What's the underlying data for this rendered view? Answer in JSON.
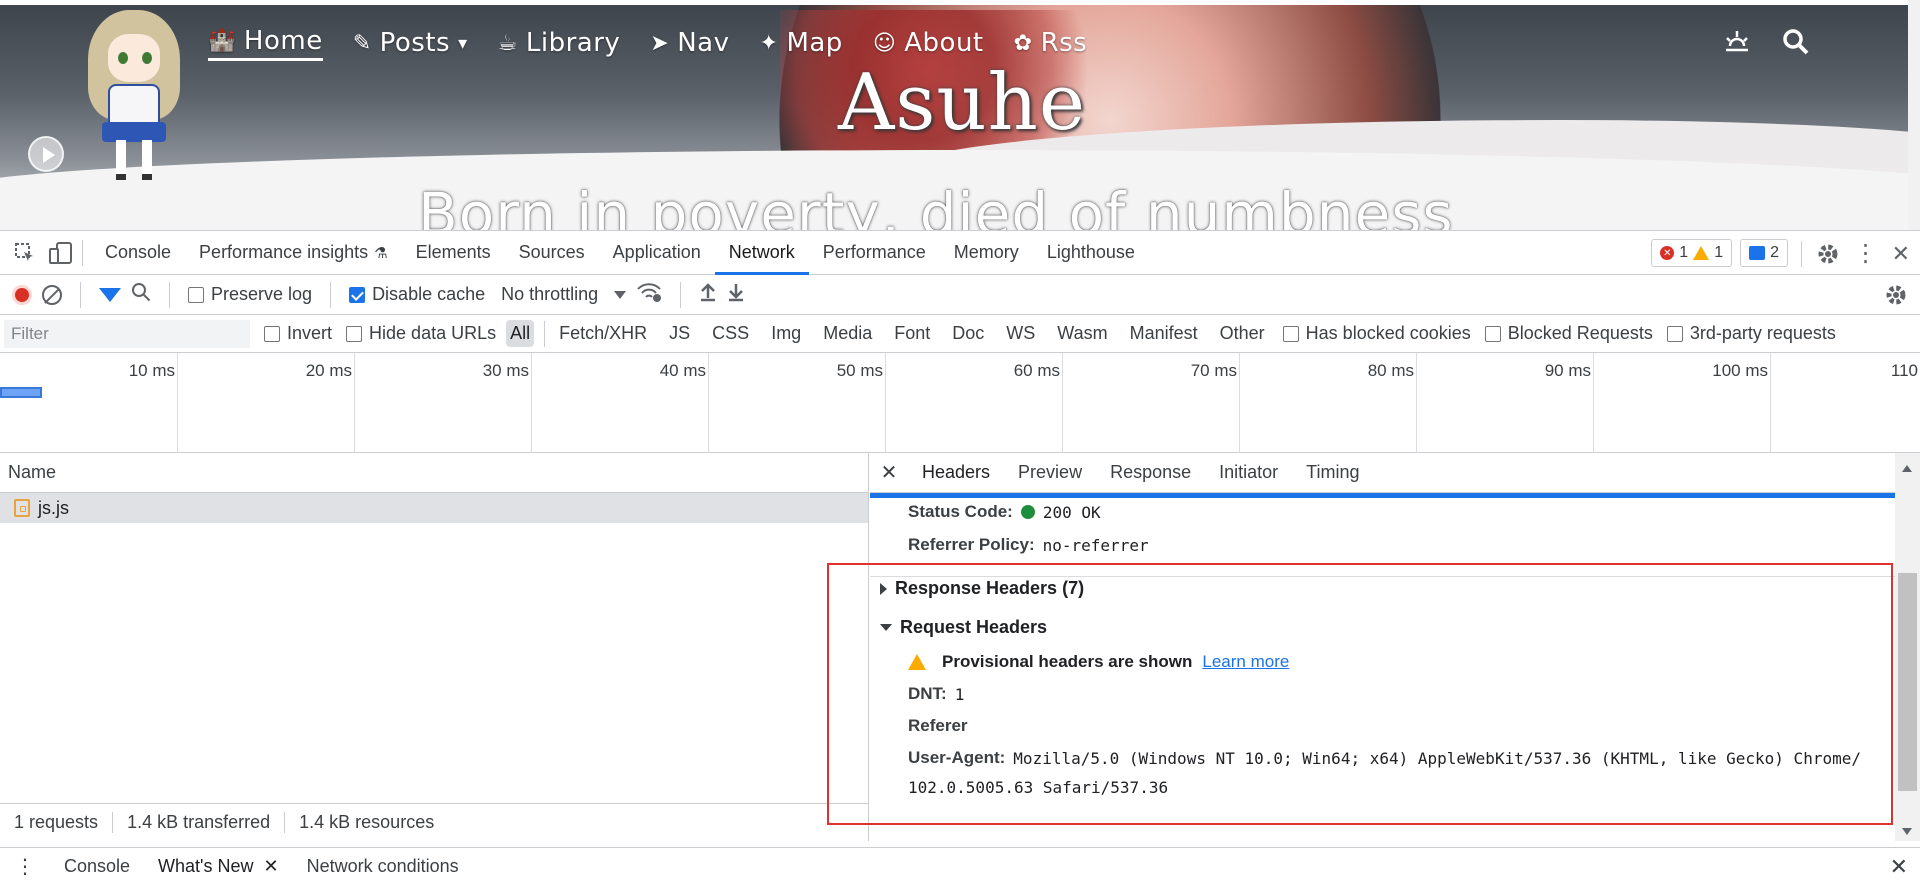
{
  "site": {
    "nav": [
      {
        "icon": "castle-icon",
        "glyph": "🏰",
        "label": "Home"
      },
      {
        "icon": "feather-icon",
        "glyph": "✎",
        "label": "Posts",
        "has_dropdown": true
      },
      {
        "icon": "cup-icon",
        "glyph": "☕",
        "label": "Library"
      },
      {
        "icon": "paper-plane-icon",
        "glyph": "➤",
        "label": "Nav"
      },
      {
        "icon": "magic-wand-icon",
        "glyph": "✦",
        "label": "Map"
      },
      {
        "icon": "user-circle-icon",
        "glyph": "☺",
        "label": "About"
      },
      {
        "icon": "flower-icon",
        "glyph": "✿",
        "label": "Rss"
      }
    ],
    "brand": "Asuhe",
    "motto": "Born in poverty, died of numbness",
    "caret": "▾"
  },
  "devtools": {
    "tabs": [
      "Console",
      "Performance insights",
      "Elements",
      "Sources",
      "Application",
      "Network",
      "Performance",
      "Memory",
      "Lighthouse"
    ],
    "active_tab": "Network",
    "performance_insights_flask": "⚗",
    "errors": "1",
    "warnings": "1",
    "messages": "2",
    "toolbar": {
      "preserve_log": "Preserve log",
      "disable_cache": "Disable cache",
      "throttling": "No throttling"
    },
    "filter": {
      "placeholder": "Filter",
      "invert": "Invert",
      "hide_data_urls": "Hide data URLs",
      "types": [
        "All",
        "Fetch/XHR",
        "JS",
        "CSS",
        "Img",
        "Media",
        "Font",
        "Doc",
        "WS",
        "Wasm",
        "Manifest",
        "Other"
      ],
      "active_type": "All",
      "has_blocked_cookies": "Has blocked cookies",
      "blocked_requests": "Blocked Requests",
      "third_party": "3rd-party requests"
    },
    "timeline_ticks": [
      "10 ms",
      "20 ms",
      "30 ms",
      "40 ms",
      "50 ms",
      "60 ms",
      "70 ms",
      "80 ms",
      "90 ms",
      "100 ms",
      "110"
    ],
    "request_list": {
      "header": "Name",
      "rows": [
        "js.js"
      ]
    },
    "status_bar": [
      "1 requests",
      "1.4 kB transferred",
      "1.4 kB resources"
    ],
    "detail_tabs": [
      "Headers",
      "Preview",
      "Response",
      "Initiator",
      "Timing"
    ],
    "active_detail_tab": "Headers",
    "headers": {
      "status_code_key": "Status Code:",
      "status_code_value": "200 OK",
      "referrer_policy_key": "Referrer Policy:",
      "referrer_policy_value": "no-referrer",
      "response_headers": "Response Headers (7)",
      "request_headers": "Request Headers",
      "provisional": "Provisional headers are shown",
      "learn_more": "Learn more",
      "dnt_key": "DNT:",
      "dnt_value": "1",
      "referer_key": "Referer",
      "ua_key": "User-Agent:",
      "ua_value_1": "Mozilla/5.0 (Windows NT 10.0; Win64; x64) AppleWebKit/537.36 (KHTML, like Gecko) Chrome/",
      "ua_value_2": "102.0.5005.63 Safari/537.36"
    },
    "drawer_tabs": [
      "Console",
      "What's New",
      "Network conditions"
    ],
    "close_glyph": "✕",
    "kebab_glyph": "⋮"
  }
}
